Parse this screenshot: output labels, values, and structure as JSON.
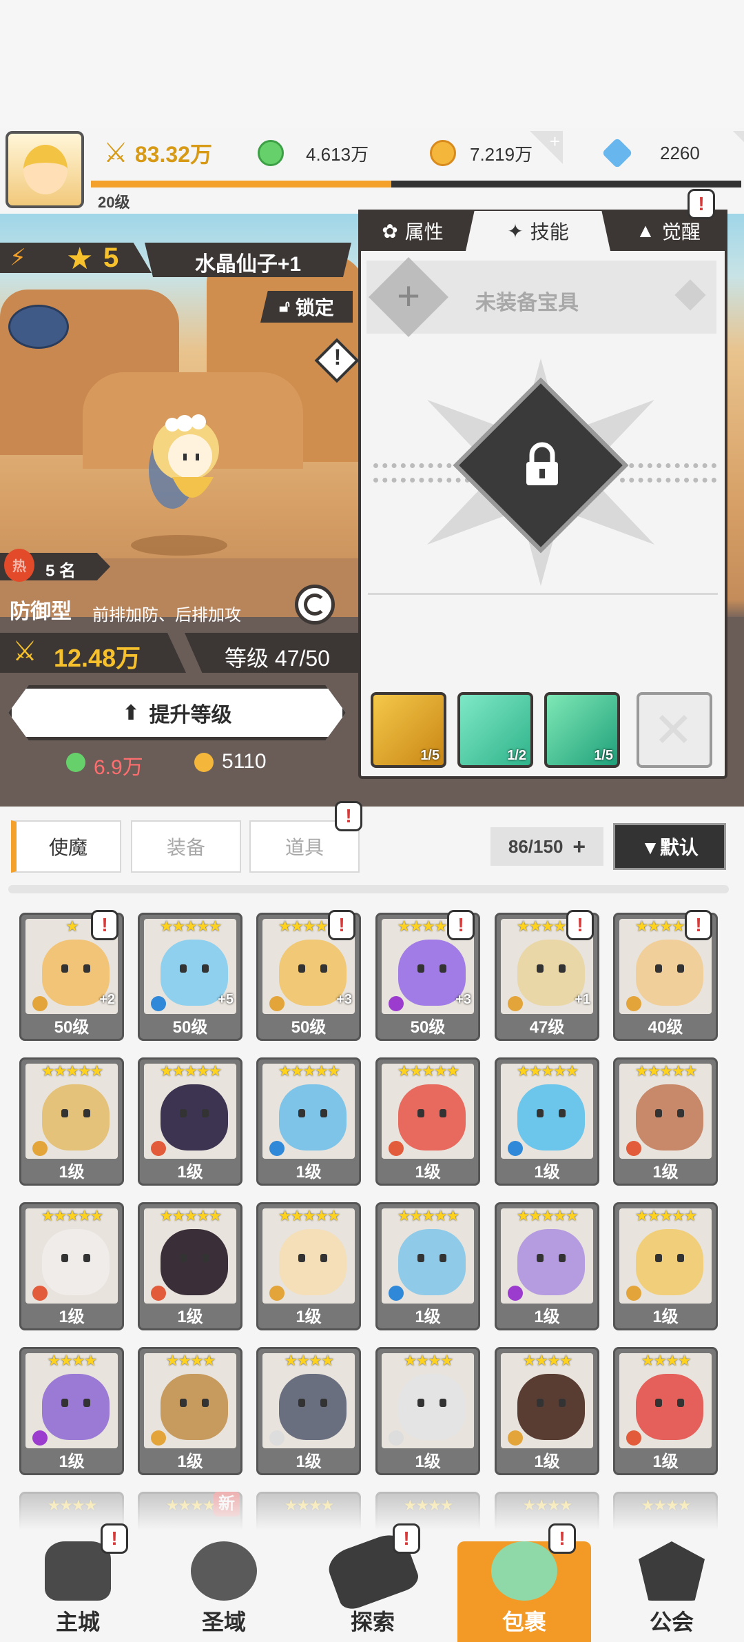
{
  "resources": {
    "power": "83.32万",
    "green_currency": "4.613万",
    "gold_currency": "7.219万",
    "gems": "2260",
    "player_level": "20级",
    "plus_sign": "+"
  },
  "hero": {
    "stars": "5",
    "name": "水晶仙子+1",
    "lock_label": "锁定",
    "hot_rank": "5 名",
    "hot_icon": "热",
    "role_type": "防御型",
    "role_desc": "前排加防、后排加攻",
    "power": "12.48万",
    "level": "等级 47/50",
    "upgrade_label": "提升等级",
    "cost_green": "6.9万",
    "cost_gold": "5110"
  },
  "panel": {
    "tabs": [
      "属性",
      "技能",
      "觉醒"
    ],
    "active_tab": "技能",
    "treasure_label": "未装备宝具",
    "skills": [
      {
        "count": "1/5",
        "color": "#e0a020"
      },
      {
        "count": "1/2",
        "color": "#3fc9a0"
      },
      {
        "count": "1/5",
        "color": "#33c28a"
      }
    ]
  },
  "inventory": {
    "tabs": [
      "使魔",
      "装备",
      "道具"
    ],
    "active_tab": "使魔",
    "capacity": "86/150",
    "sort_label": "▼默认",
    "rows": [
      [
        {
          "stars": "★",
          "level": "50级",
          "plus": "+2",
          "color": "#f2c477",
          "elem": "#e3a43a",
          "notice": true
        },
        {
          "stars": "★★★★★",
          "level": "50级",
          "plus": "+5",
          "color": "#8fd0ee",
          "elem": "#2f88d8",
          "notice": false
        },
        {
          "stars": "★★★★★",
          "level": "50级",
          "plus": "+3",
          "color": "#f0c876",
          "elem": "#e3a43a",
          "notice": true
        },
        {
          "stars": "★★★★★",
          "level": "50级",
          "plus": "+3",
          "color": "#a27ce6",
          "elem": "#9b3ccf",
          "notice": true
        },
        {
          "stars": "★★★★★",
          "level": "47级",
          "plus": "+1",
          "color": "#e9d7a8",
          "elem": "#e3a43a",
          "notice": true
        },
        {
          "stars": "★★★★★",
          "level": "40级",
          "plus": "",
          "color": "#f1cf9a",
          "elem": "#e3a43a",
          "notice": true
        }
      ],
      [
        {
          "stars": "★★★★★",
          "level": "1级",
          "plus": "",
          "color": "#e4c27a",
          "elem": "#e3a43a",
          "notice": false
        },
        {
          "stars": "★★★★★",
          "level": "1级",
          "plus": "",
          "color": "#3c3450",
          "elem": "#e25b3a",
          "notice": false
        },
        {
          "stars": "★★★★★",
          "level": "1级",
          "plus": "",
          "color": "#7ec3e8",
          "elem": "#2f88d8",
          "notice": false
        },
        {
          "stars": "★★★★★",
          "level": "1级",
          "plus": "",
          "color": "#e86a5e",
          "elem": "#e25b3a",
          "notice": false
        },
        {
          "stars": "★★★★★",
          "level": "1级",
          "plus": "",
          "color": "#6cc5ea",
          "elem": "#2f88d8",
          "notice": false
        },
        {
          "stars": "★★★★★",
          "level": "1级",
          "plus": "",
          "color": "#c8896b",
          "elem": "#e25b3a",
          "notice": false
        }
      ],
      [
        {
          "stars": "★★★★★",
          "level": "1级",
          "plus": "",
          "color": "#f0ecea",
          "elem": "#e25b3a",
          "notice": false
        },
        {
          "stars": "★★★★★",
          "level": "1级",
          "plus": "",
          "color": "#3a2f38",
          "elem": "#e25b3a",
          "notice": false
        },
        {
          "stars": "★★★★★",
          "level": "1级",
          "plus": "",
          "color": "#f4dfb8",
          "elem": "#e3a43a",
          "notice": false
        },
        {
          "stars": "★★★★★",
          "level": "1级",
          "plus": "",
          "color": "#8fcbe8",
          "elem": "#2f88d8",
          "notice": false
        },
        {
          "stars": "★★★★★",
          "level": "1级",
          "plus": "",
          "color": "#b59be0",
          "elem": "#9b3ccf",
          "notice": false
        },
        {
          "stars": "★★★★★",
          "level": "1级",
          "plus": "",
          "color": "#f1cf7a",
          "elem": "#e3a43a",
          "notice": false
        }
      ],
      [
        {
          "stars": "★★★★",
          "level": "1级",
          "plus": "",
          "color": "#9b7ad6",
          "elem": "#9b3ccf",
          "notice": false
        },
        {
          "stars": "★★★★",
          "level": "1级",
          "plus": "",
          "color": "#c79a5e",
          "elem": "#e3a43a",
          "notice": false
        },
        {
          "stars": "★★★★",
          "level": "1级",
          "plus": "",
          "color": "#6a6f80",
          "elem": "#dddddd",
          "notice": false
        },
        {
          "stars": "★★★★",
          "level": "1级",
          "plus": "",
          "color": "#e4e4e4",
          "elem": "#dddddd",
          "notice": false
        },
        {
          "stars": "★★★★",
          "level": "1级",
          "plus": "",
          "color": "#5a3d32",
          "elem": "#e3a43a",
          "notice": false
        },
        {
          "stars": "★★★★",
          "level": "1级",
          "plus": "",
          "color": "#e5605a",
          "elem": "#e25b3a",
          "notice": false
        }
      ]
    ],
    "partial_row_new_badge": "新",
    "partial_row_stars": "★★★★"
  },
  "nav": {
    "items": [
      "主城",
      "圣域",
      "探索",
      "包裹",
      "公会"
    ],
    "active": "包裹"
  },
  "notice_mark": "!"
}
